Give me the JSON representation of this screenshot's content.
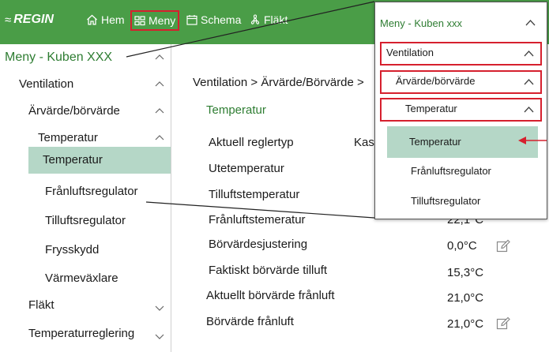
{
  "topbar": {
    "logo": "REGIN",
    "nav": [
      {
        "label": "Hem",
        "icon": "home-icon"
      },
      {
        "label": "Meny",
        "icon": "menu-grid-icon"
      },
      {
        "label": "Schema",
        "icon": "calendar-icon"
      },
      {
        "label": "Fläkt",
        "icon": "fan-icon"
      }
    ],
    "accent_color": "#4a9d47"
  },
  "sidebar": {
    "title": "Meny - Kuben XXX",
    "items": [
      {
        "label": "Ventilation"
      },
      {
        "label": "Ärvärde/börvärde"
      },
      {
        "label": "Temperatur"
      },
      {
        "label": "Temperatur",
        "selected": true
      },
      {
        "label": "Frånluftsregulator"
      },
      {
        "label": "Tilluftsregulator"
      },
      {
        "label": "Frysskydd"
      },
      {
        "label": "Värmeväxlare"
      },
      {
        "label": "Fläkt"
      },
      {
        "label": "Temperaturreglering"
      }
    ],
    "selected_color": "#b5d7c7"
  },
  "main": {
    "breadcrumb": "Ventilation > Ärvärde/Börvärde >",
    "section_title": "Temperatur",
    "params": [
      {
        "label": "Aktuell reglertyp",
        "value": "Kas"
      },
      {
        "label": "Utetemperatur",
        "value": ""
      },
      {
        "label": "Tilluftstemperatur",
        "value": ""
      },
      {
        "label": "Frånluftstemeratur",
        "value": "22,1°C"
      },
      {
        "label": "Börvärdesjustering",
        "value": "0,0°C",
        "editable": true
      },
      {
        "label": "Faktiskt börvärde tilluft",
        "value": "15,3°C"
      },
      {
        "label": "Aktuellt börvärde frånluft",
        "value": "21,0°C"
      },
      {
        "label": "Börvärde frånluft",
        "value": "21,0°C",
        "editable": true
      }
    ]
  },
  "overlay": {
    "title": "Meny - Kuben xxx",
    "levels": [
      "Ventilation",
      "Ärvärde/börvärde",
      "Temperatur"
    ],
    "selected": "Temperatur",
    "items": [
      "Frånluftsregulator",
      "Tilluftsregulator"
    ],
    "highlight_color": "#d6202e"
  }
}
